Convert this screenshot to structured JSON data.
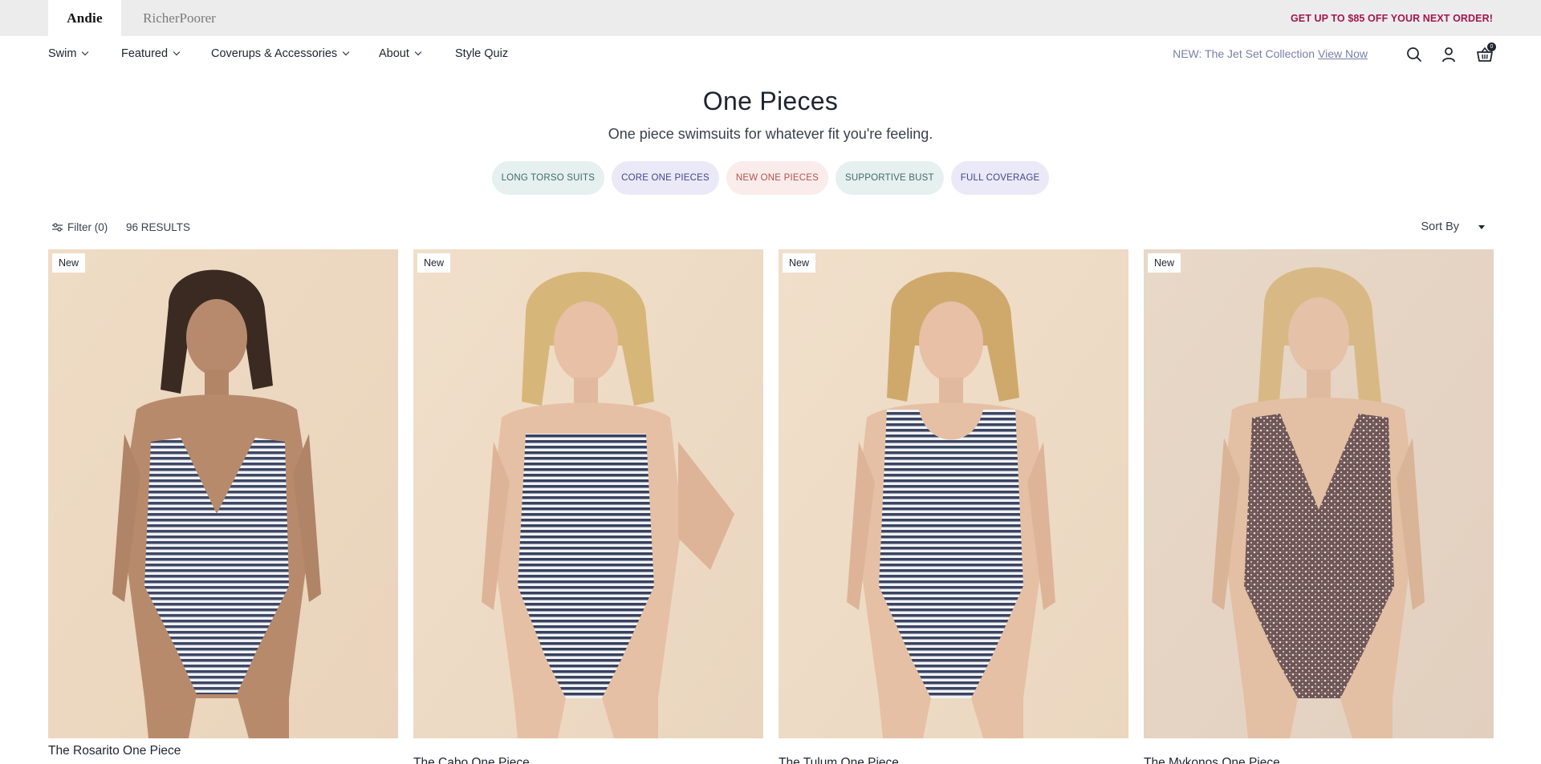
{
  "brandbar": {
    "brands": [
      "Andie",
      "RicherPoorer"
    ],
    "promo": "GET UP TO $85 OFF YOUR NEXT ORDER!"
  },
  "nav": {
    "items": [
      {
        "label": "Swim",
        "has_dropdown": true
      },
      {
        "label": "Featured",
        "has_dropdown": true
      },
      {
        "label": "Coverups & Accessories",
        "has_dropdown": true
      },
      {
        "label": "About",
        "has_dropdown": true
      },
      {
        "label": "Style Quiz",
        "has_dropdown": false
      }
    ],
    "announcement_text": "NEW: The Jet Set Collection",
    "announcement_link": "View Now",
    "icons": [
      "search-icon",
      "account-icon",
      "basket-icon"
    ],
    "cart_count": "0"
  },
  "page": {
    "title": "One Pieces",
    "subtitle": "One piece swimsuits for whatever fit you're feeling."
  },
  "pills": [
    {
      "label": "LONG TORSO SUITS",
      "bg": "#e6f0ee",
      "fg": "#3f6b66"
    },
    {
      "label": "CORE ONE PIECES",
      "bg": "#ebe9f7",
      "fg": "#43438f"
    },
    {
      "label": "NEW ONE PIECES",
      "bg": "#faeceb",
      "fg": "#b5534d"
    },
    {
      "label": "SUPPORTIVE BUST",
      "bg": "#e6f0ee",
      "fg": "#3f6b66"
    },
    {
      "label": "FULL COVERAGE",
      "bg": "#ebe9f7",
      "fg": "#43438f"
    }
  ],
  "toolbar": {
    "filter_label": "Filter (0)",
    "results_label": "96 RESULTS",
    "sort_label": "Sort By"
  },
  "products": [
    {
      "badge": "New",
      "name": "The Rosarito One Piece",
      "pattern": "stripe"
    },
    {
      "badge": "New",
      "name": "The Cabo One Piece",
      "pattern": "stripe"
    },
    {
      "badge": "New",
      "name": "The Tulum One Piece",
      "pattern": "stripe"
    },
    {
      "badge": "New",
      "name": "The Mykonos One Piece",
      "pattern": "floral"
    }
  ],
  "colors": {
    "promo": "#a0174f",
    "text": "#1f2430",
    "link_muted": "#7a7fa8",
    "brandbar_bg": "#ececec"
  }
}
